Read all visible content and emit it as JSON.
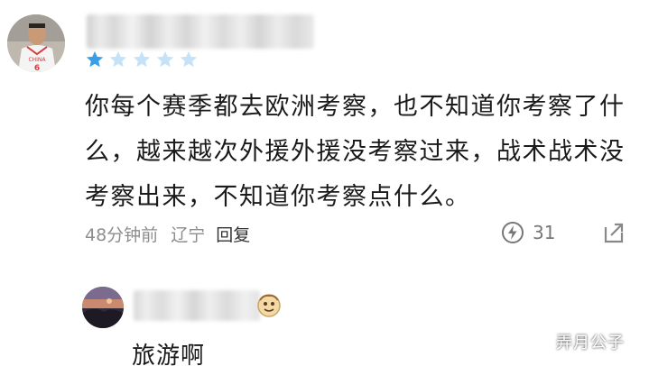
{
  "comment": {
    "avatar": {
      "icon": "player-avatar",
      "jersey_text": "CHINA",
      "jersey_number": "6"
    },
    "username_hidden": true,
    "rating": {
      "filled": 1,
      "total": 5,
      "filled_color": "#3a9ee6",
      "empty_color": "#c5e2f6"
    },
    "text": "你每个赛季都去欧洲考察，也不知道你考察了什么，越来越次外援外援没考察过来，战术战术没考察出来，不知道你考察点什么。",
    "time": "48分钟前",
    "location": "辽宁",
    "reply_label": "回复",
    "likes": "31",
    "like_icon": "lightning-like-icon",
    "share_icon": "share-arrow-icon"
  },
  "reply": {
    "avatar": {
      "icon": "landscape-avatar"
    },
    "username_hidden": true,
    "badge_icon": "emoji-badge-icon",
    "text": "旅游啊"
  },
  "watermark": "弄月公子"
}
